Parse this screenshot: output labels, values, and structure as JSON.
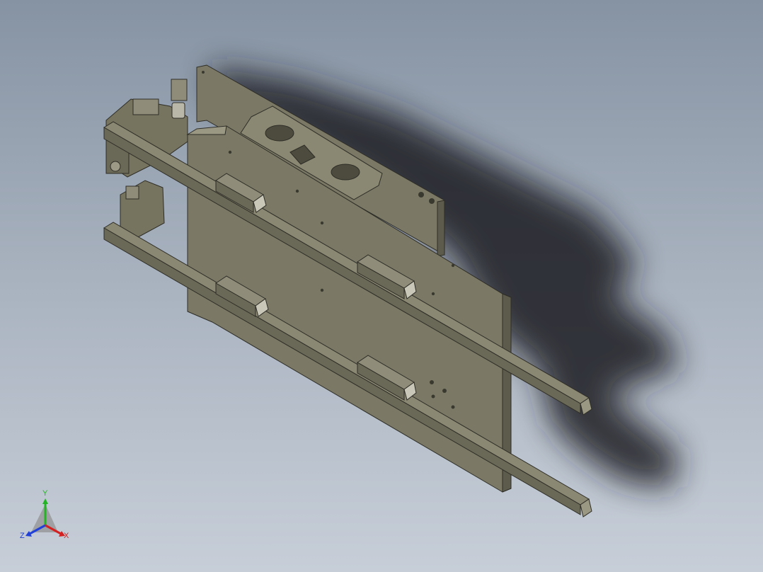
{
  "viewport": {
    "background_top": "#8693a3",
    "background_bottom": "#c7ced8"
  },
  "model": {
    "part_color": "#7b7966",
    "part_dark": "#5d5b4c",
    "part_light": "#9a9883",
    "edge_color": "#2e2d26",
    "shadow_color": "#1c1f24"
  },
  "triad": {
    "x_label": "X",
    "y_label": "Y",
    "z_label": "Z",
    "x_color": "#d42020",
    "y_color": "#22b422",
    "z_color": "#2040d8"
  }
}
